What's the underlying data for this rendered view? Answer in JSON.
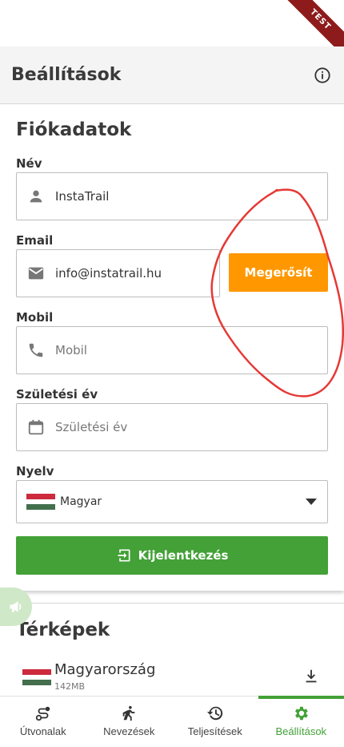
{
  "ribbon": "TEST",
  "appbar": {
    "title": "Beállítások"
  },
  "account": {
    "title": "Fiókadatok",
    "name": {
      "label": "Név",
      "value": "InstaTrail"
    },
    "email": {
      "label": "Email",
      "value": "info@instatrail.hu",
      "confirm_label": "Megerősít"
    },
    "mobile": {
      "label": "Mobil",
      "placeholder": "Mobil"
    },
    "birth_year": {
      "label": "Születési év",
      "placeholder": "Születési év"
    },
    "language": {
      "label": "Nyelv",
      "value": "Magyar"
    },
    "logout_label": "Kijelentkezés"
  },
  "maps": {
    "title": "Térképek",
    "items": [
      {
        "name": "Magyarország",
        "size": "142MB"
      }
    ]
  },
  "nav": {
    "items": [
      {
        "label": "Útvonalak",
        "icon": "route-icon"
      },
      {
        "label": "Nevezések",
        "icon": "runner-icon"
      },
      {
        "label": "Teljesítések",
        "icon": "history-icon"
      },
      {
        "label": "Beállítások",
        "icon": "gear-icon",
        "active": true
      }
    ]
  },
  "colors": {
    "accent": "#43a137",
    "warning": "#ff9800",
    "annotation": "#e53935"
  }
}
